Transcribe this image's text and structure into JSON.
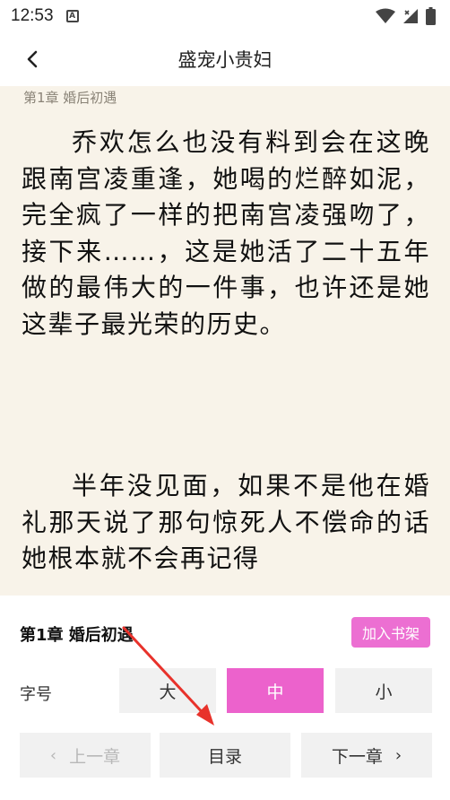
{
  "status_bar": {
    "time": "12:53",
    "notification_glyph": "A",
    "icons": [
      "wifi-icon",
      "signal-icon",
      "battery-icon"
    ]
  },
  "header": {
    "title": "盛宠小贵妇"
  },
  "reader": {
    "chapter_header": "第1章 婚后初遇",
    "paragraphs": [
      "乔欢怎么也没有料到会在这晚跟南宫凌重逢，她喝的烂醉如泥，完全疯了一样的把南宫凌强吻了，接下来……，这是她活了二十五年做的最伟大的一件事，也许还是她这辈子最光荣的历史。",
      "半年没见面，如果不是他在婚礼那天说了那句惊死人不偿命的话她根本就不会再记得"
    ]
  },
  "panel": {
    "chapter_title": "第1章 婚后初遇",
    "add_shelf_label": "加入书架",
    "font_size_label": "字号",
    "font_sizes": [
      {
        "label": "大",
        "active": false
      },
      {
        "label": "中",
        "active": true
      },
      {
        "label": "小",
        "active": false
      }
    ],
    "prev_label": "上一章",
    "toc_label": "目录",
    "next_label": "下一章"
  },
  "colors": {
    "accent": "#ec62cc",
    "reader_bg": "#f8f3e9",
    "annotation_arrow": "#e8322b"
  }
}
